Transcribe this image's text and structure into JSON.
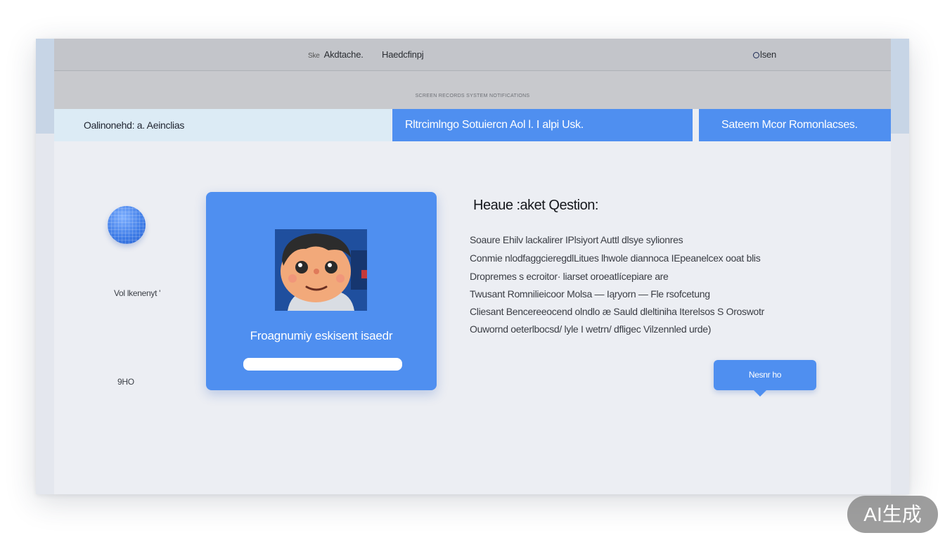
{
  "nav": {
    "item1_prefix": "Ske",
    "item1": "Akdtache.",
    "item2": "Haedcfinpj",
    "right": "lsen"
  },
  "subbar": {
    "text": "SCREEN RECORDS SYSTEM NOTIFICATIONS"
  },
  "tabs": {
    "left": "Oalinonehd: a. Aeinclias",
    "middle": "Rltrcimlngo Sotuiercn Aol l. I alpi Usk.",
    "right": "Sateem Mcor Romonlacses."
  },
  "sidebar": {
    "label1": "Vol lkenenyt '",
    "label2": "9HO"
  },
  "card": {
    "title": "Froagnumiy eskisent isaedr",
    "input_value": ""
  },
  "content": {
    "heading": "Heaue :aket Qestion:",
    "lines": [
      "Soaure Ehilv lackalirer IPlsiyort Auttl dlsye sylionres",
      "Conmie nlodfaggcieregdlLitues lhwole diannoca IEpeanelcex ooat blis",
      "Dropremes s ecroitor· liarset oroeatlícepiare are",
      "Twusant Romnilieicoor Molsa — Iąryorn — Fle rsofcetung",
      "Cliesant Bencereeocend olndlo æ Sauld dleltiniha Iterelsos S Oroswotr",
      "Ouwornd oeterlbocsd/ lyle I wetrn/ dfligec Vilzennled urde)"
    ]
  },
  "help_button": {
    "label": "Nesnr ho"
  },
  "watermark": {
    "text": "AI生成"
  },
  "colors": {
    "accent": "#4f8ff0",
    "nav": "#c3c5ca",
    "tab_light": "#dcebf5",
    "background": "#eceef3"
  },
  "icons": [
    "globe-orb-icon",
    "avatar-illustration",
    "dot-icon"
  ]
}
